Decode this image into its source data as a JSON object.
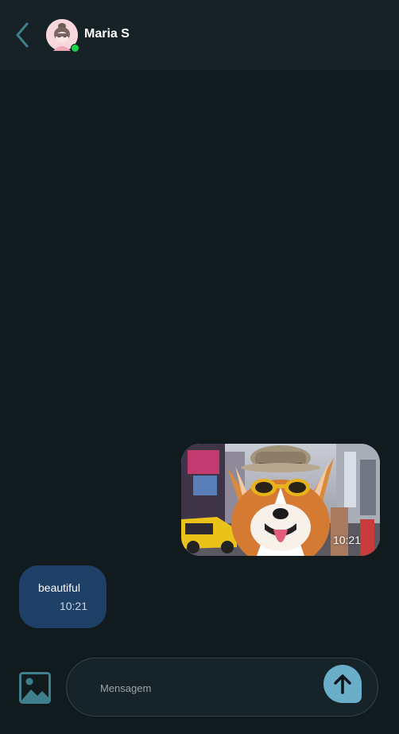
{
  "header": {
    "contact_name": "Maria S",
    "status": "online",
    "online_color": "#19d34b",
    "back_icon": "chevron-left-icon"
  },
  "messages": [
    {
      "type": "image",
      "direction": "outgoing",
      "time": "10:21",
      "image": "corgi-in-sunglasses-city-photo"
    },
    {
      "type": "text",
      "direction": "incoming",
      "text": "beautiful",
      "time": "10:21"
    }
  ],
  "composer": {
    "placeholder": "Mensagem",
    "attach_icon": "image-icon",
    "send_icon": "arrow-up-icon"
  },
  "colors": {
    "background": "#111a1d",
    "header": "#172227",
    "incoming_bubble": "#1e3f66",
    "send_button": "#6aaec9",
    "accent_icon": "#3f7f8c"
  }
}
